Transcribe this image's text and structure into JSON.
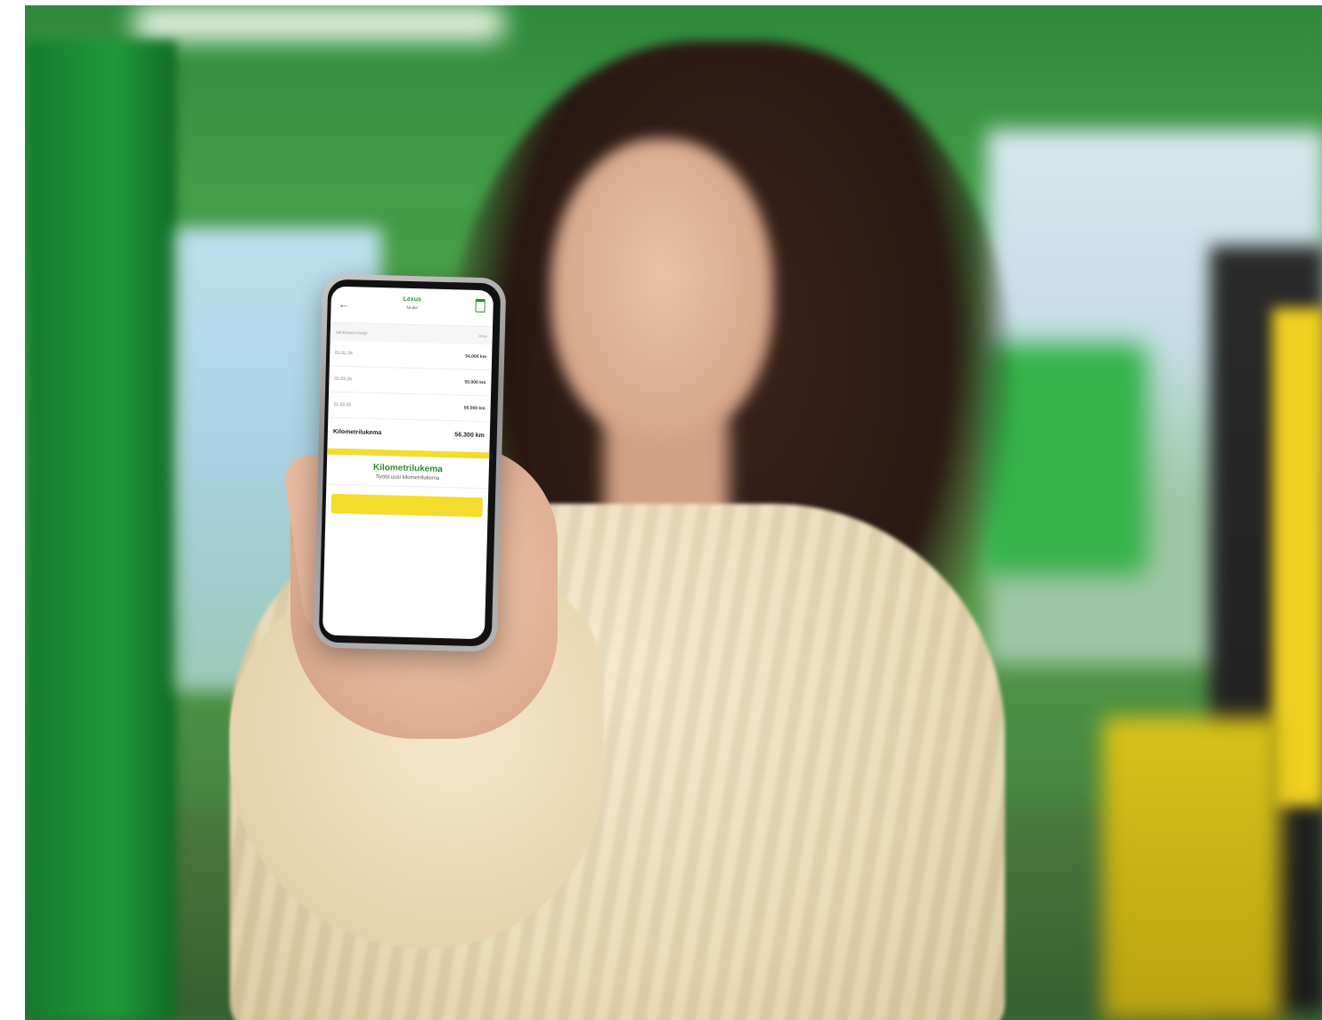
{
  "app": {
    "header_title": "Lexus",
    "header_subtitle": "Model",
    "list_header_left": "Sähköisesti lisätyt",
    "list_header_right": "Arvo",
    "rows": [
      {
        "date": "01.01.25",
        "value": "54.000 km"
      },
      {
        "date": "01.03.25",
        "value": "55.000 km"
      },
      {
        "date": "01.02.25",
        "value": "56.000 km"
      }
    ],
    "total_label": "Kilometrilukema",
    "total_value": "56.300 km",
    "sheet_kicker": "",
    "sheet_title": "Kilometrilukema",
    "sheet_subtitle": "Syötä uusi kilometrilukema",
    "sheet_warning": "",
    "sheet_note": "",
    "save_label": "",
    "cancel_label": ""
  },
  "colors": {
    "brand_green": "#2e8b3a",
    "accent_yellow": "#f3dc2b"
  },
  "icons": {
    "back": "arrow-left-icon",
    "delete": "trash-icon"
  }
}
